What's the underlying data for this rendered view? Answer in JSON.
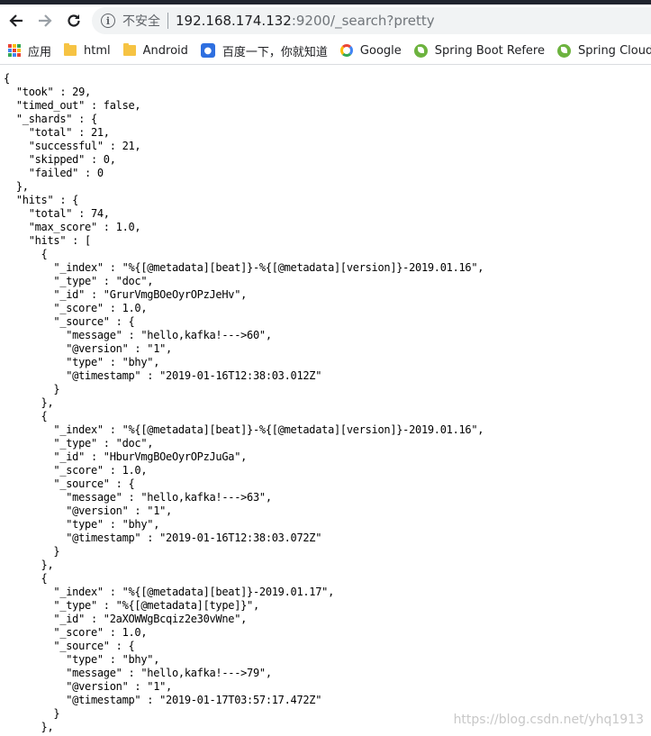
{
  "browser": {
    "security_label": "不安全",
    "url_host": "192.168.174.132",
    "url_rest": ":9200/_search?pretty"
  },
  "bookmarks": [
    {
      "label": "应用",
      "icon": "apps-grid-icon"
    },
    {
      "label": "html",
      "icon": "folder-icon"
    },
    {
      "label": "Android",
      "icon": "folder-icon"
    },
    {
      "label": "百度一下，你就知道",
      "icon": "baidu-paw-icon"
    },
    {
      "label": "Google",
      "icon": "google-g-icon"
    },
    {
      "label": "Spring Boot Refere",
      "icon": "spring-leaf-icon"
    },
    {
      "label": "Spring Cloud",
      "icon": "spring-leaf-icon"
    }
  ],
  "json_lines": [
    "{",
    "  \"took\" : 29,",
    "  \"timed_out\" : false,",
    "  \"_shards\" : {",
    "    \"total\" : 21,",
    "    \"successful\" : 21,",
    "    \"skipped\" : 0,",
    "    \"failed\" : 0",
    "  },",
    "  \"hits\" : {",
    "    \"total\" : 74,",
    "    \"max_score\" : 1.0,",
    "    \"hits\" : [",
    "      {",
    "        \"_index\" : \"%{[@metadata][beat]}-%{[@metadata][version]}-2019.01.16\",",
    "        \"_type\" : \"doc\",",
    "        \"_id\" : \"GrurVmgBOeOyrOPzJeHv\",",
    "        \"_score\" : 1.0,",
    "        \"_source\" : {",
    "          \"message\" : \"hello,kafka!--->60\",",
    "          \"@version\" : \"1\",",
    "          \"type\" : \"bhy\",",
    "          \"@timestamp\" : \"2019-01-16T12:38:03.012Z\"",
    "        }",
    "      },",
    "      {",
    "        \"_index\" : \"%{[@metadata][beat]}-%{[@metadata][version]}-2019.01.16\",",
    "        \"_type\" : \"doc\",",
    "        \"_id\" : \"HburVmgBOeOyrOPzJuGa\",",
    "        \"_score\" : 1.0,",
    "        \"_source\" : {",
    "          \"message\" : \"hello,kafka!--->63\",",
    "          \"@version\" : \"1\",",
    "          \"type\" : \"bhy\",",
    "          \"@timestamp\" : \"2019-01-16T12:38:03.072Z\"",
    "        }",
    "      },",
    "      {",
    "        \"_index\" : \"%{[@metadata][beat]}-2019.01.17\",",
    "        \"_type\" : \"%{[@metadata][type]}\",",
    "        \"_id\" : \"2aXOWWgBcqiz2e30vWne\",",
    "        \"_score\" : 1.0,",
    "        \"_source\" : {",
    "          \"type\" : \"bhy\",",
    "          \"message\" : \"hello,kafka!--->79\",",
    "          \"@version\" : \"1\",",
    "          \"@timestamp\" : \"2019-01-17T03:57:17.472Z\"",
    "        }",
    "      },"
  ],
  "watermark": "https://blog.csdn.net/yhq1913"
}
